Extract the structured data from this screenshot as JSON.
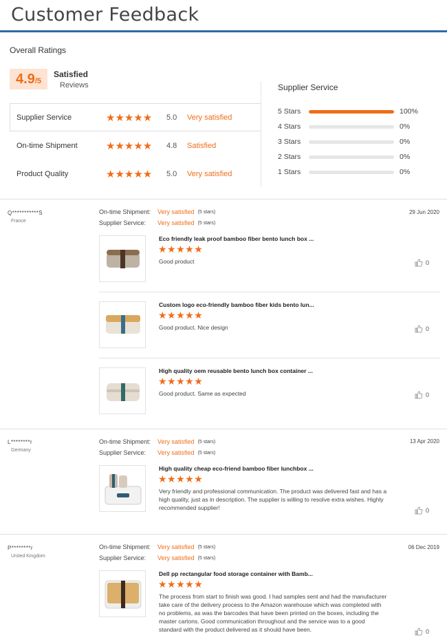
{
  "header": {
    "title": "Customer Feedback"
  },
  "overall": {
    "label": "Overall Ratings",
    "score": "4.9",
    "score_max": "/5",
    "score_word": "Satisfied",
    "reviews_label": "Reviews"
  },
  "ratings": [
    {
      "name": "Supplier Service",
      "stars": "★★★★★",
      "value": "5.0",
      "word": "Very satisfied"
    },
    {
      "name": "On-time Shipment",
      "stars": "★★★★★",
      "value": "4.8",
      "word": "Satisfied"
    },
    {
      "name": "Product Quality",
      "stars": "★★★★★",
      "value": "5.0",
      "word": "Very satisfied"
    }
  ],
  "supplier_service": {
    "title": "Supplier Service",
    "rows": [
      {
        "label": "5 Stars",
        "pct": "100%",
        "fraction": 1.0
      },
      {
        "label": "4 Stars",
        "pct": "0%",
        "fraction": 0
      },
      {
        "label": "3 Stars",
        "pct": "0%",
        "fraction": 0
      },
      {
        "label": "2 Stars",
        "pct": "0%",
        "fraction": 0
      },
      {
        "label": "1 Stars",
        "pct": "0%",
        "fraction": 0
      }
    ]
  },
  "colors": {
    "accent": "#ef6c19",
    "rule": "#2c6aa8"
  },
  "reviews": [
    {
      "user": "Q***********S",
      "country": "France",
      "date": "29 Jun 2020",
      "shipment_label": "On-time Shipment:",
      "shipment_value": "Very satisfied",
      "shipment_stars": "(5 stars)",
      "service_label": "Supplier Service:",
      "service_value": "Very satisfied",
      "service_stars": "(5 stars)",
      "items": [
        {
          "title": "Eco friendly leak proof bamboo fiber bento lunch box ...",
          "stars": "★★★★★",
          "text": "Good product",
          "likes": "0"
        },
        {
          "title": "Custom logo eco-friendly bamboo fiber kids bento lun...",
          "stars": "★★★★★",
          "text": "Good product. Nice design",
          "likes": "0"
        },
        {
          "title": "High quality oem reusable bento lunch box container ...",
          "stars": "★★★★★",
          "text": "Good product. Same as expected",
          "likes": "0"
        }
      ]
    },
    {
      "user": "L********r",
      "country": "Germany",
      "date": "13 Apr 2020",
      "shipment_label": "On-time Shipment:",
      "shipment_value": "Very satisfied",
      "shipment_stars": "(5 stars)",
      "service_label": "Supplier Service:",
      "service_value": "Very satisfied",
      "service_stars": "(5 stars)",
      "items": [
        {
          "title": "High quality cheap eco-friend bamboo fiber lunchbox ...",
          "stars": "★★★★★",
          "text": "Very friendly and professional communication. The product was delivered fast and has a high quality, just as in description. The supplier is willing to resolve extra wishes. Highly recommended supplier!",
          "likes": "0"
        }
      ]
    },
    {
      "user": "P********r",
      "country": "United Kingdom",
      "date": "06 Dec 2019",
      "shipment_label": "On-time Shipment:",
      "shipment_value": "Very satisfied",
      "shipment_stars": "(5 stars)",
      "service_label": "Supplier Service:",
      "service_value": "Very satisfied",
      "service_stars": "(5 stars)",
      "items": [
        {
          "title": "Dell pp rectangular food storage container with Bamb...",
          "stars": "★★★★★",
          "text": "The process from start to finish was good. I had samples sent and had the manufacturer take care of the delivery process to the Amazon warehouse which was completed with no problems, as was the barcodes that have been printed on the boxes, including the master cartons. Good communication throughout and the service was to a good standard with the product delivered as it should have been.",
          "likes": "0"
        }
      ]
    }
  ]
}
